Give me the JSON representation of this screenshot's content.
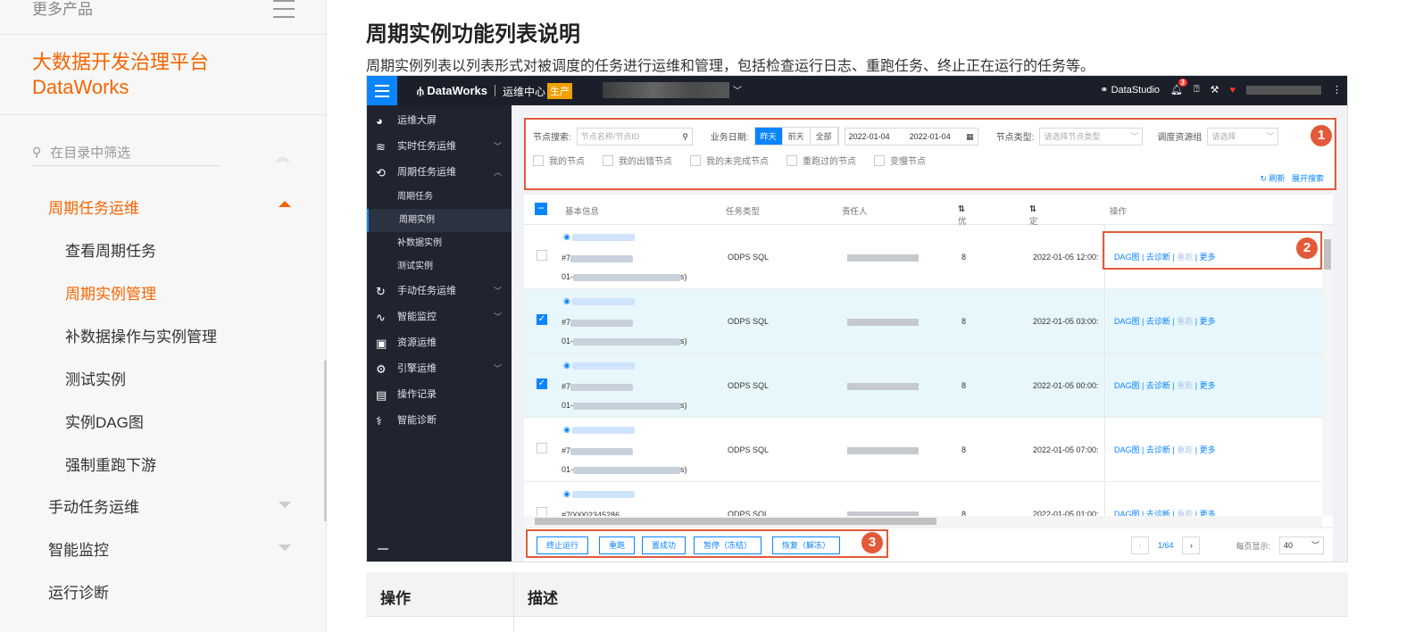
{
  "sidebar": {
    "more_products": "更多产品",
    "product_name_cn": "大数据开发治理平台",
    "product_name_en": "DataWorks",
    "filter_placeholder": "在目录中筛选",
    "items": [
      {
        "label": "周期任务运维",
        "active": true,
        "level": 1
      },
      {
        "label": "查看周期任务",
        "active": false,
        "level": 2
      },
      {
        "label": "周期实例管理",
        "active": true,
        "level": 2
      },
      {
        "label": "补数据操作与实例管理",
        "active": false,
        "level": 2
      },
      {
        "label": "测试实例",
        "active": false,
        "level": 2
      },
      {
        "label": "实例DAG图",
        "active": false,
        "level": 2
      },
      {
        "label": "强制重跑下游",
        "active": false,
        "level": 2
      },
      {
        "label": "手动任务运维",
        "active": false,
        "level": 1
      },
      {
        "label": "智能监控",
        "active": false,
        "level": 1
      },
      {
        "label": "运行诊断",
        "active": false,
        "level": 1
      }
    ]
  },
  "content": {
    "title": "周期实例功能列表说明",
    "description": "周期实例列表以列表形式对被调度的任务进行运维和管理，包括检查运行日志、重跑任务、终止正在运行的任务等。",
    "table_headers": {
      "op": "操作",
      "desc": "描述"
    }
  },
  "screenshot": {
    "topbar": {
      "logo": "DataWorks",
      "module": "运维中心",
      "env": "生产",
      "datastudio": "DataStudio",
      "notify_count": "3"
    },
    "leftnav": [
      {
        "icon": "pie-icon",
        "glyph": "◕",
        "label": "运维大屏"
      },
      {
        "icon": "realtime-icon",
        "glyph": "≋",
        "label": "实时任务运维",
        "arrow": "﹀"
      },
      {
        "icon": "cycle-icon",
        "glyph": "⟲",
        "label": "周期任务运维",
        "arrow": "︿"
      },
      {
        "sub": true,
        "label": "周期任务"
      },
      {
        "sub": true,
        "label": "周期实例",
        "selected": true
      },
      {
        "sub": true,
        "label": "补数据实例"
      },
      {
        "sub": true,
        "label": "测试实例"
      },
      {
        "icon": "manual-icon",
        "glyph": "↻",
        "label": "手动任务运维",
        "arrow": "﹀"
      },
      {
        "icon": "monitor-icon",
        "glyph": "∿",
        "label": "智能监控",
        "arrow": "﹀"
      },
      {
        "icon": "resource-icon",
        "glyph": "▣",
        "label": "资源运维"
      },
      {
        "icon": "engine-icon",
        "glyph": "⚙",
        "label": "引擎运维",
        "arrow": "﹀"
      },
      {
        "icon": "log-icon",
        "glyph": "▤",
        "label": "操作记录"
      },
      {
        "icon": "diagnose-icon",
        "glyph": "⚕",
        "label": "智能诊断"
      }
    ],
    "search": {
      "node_search_label": "节点搜索:",
      "node_search_placeholder": "节点名称/节点ID",
      "biz_date_label": "业务日期:",
      "date_buttons": [
        "昨天",
        "前天",
        "全部"
      ],
      "date_from": "2022-01-04",
      "date_to": "2022-01-04",
      "node_type_label": "节点类型:",
      "node_type_placeholder": "请选择节点类型",
      "resource_group_label": "调度资源组",
      "resource_group_placeholder": "请选择",
      "checkboxes": [
        "我的节点",
        "我的出错节点",
        "我的未完成节点",
        "重跑过的节点",
        "变慢节点"
      ],
      "refresh": "刷新",
      "expand": "展开搜索"
    },
    "grid": {
      "headers": [
        "基本信息",
        "任务类型",
        "责任人",
        "优先级",
        "定时时间",
        "操作"
      ],
      "rows": [
        {
          "id": "#7",
          "time": "01-",
          "suffix": "s)",
          "type": "ODPS SQL",
          "priority": "8",
          "schedule": "2022-01-05 12:00:",
          "checked": false
        },
        {
          "id": "#7",
          "time": "01-",
          "suffix": "s)",
          "type": "ODPS SQL",
          "priority": "8",
          "schedule": "2022-01-05 03:00:",
          "checked": true
        },
        {
          "id": "#7",
          "time": "01-",
          "suffix": "s)",
          "type": "ODPS SQL",
          "priority": "8",
          "schedule": "2022-01-05 00:00:",
          "checked": true
        },
        {
          "id": "#7",
          "time": "01-",
          "suffix": "s)",
          "type": "ODPS SQL",
          "priority": "8",
          "schedule": "2022-01-05 07:00:",
          "checked": false
        },
        {
          "id": "#700002345286",
          "time": "",
          "suffix": "",
          "type": "ODPS SQL",
          "priority": "8",
          "schedule": "2022-01-05 01:00:",
          "checked": false
        }
      ],
      "ops": {
        "dag": "DAG图",
        "diagnose": "去诊断",
        "rerun": "重跑",
        "more": "更多"
      }
    },
    "footer": {
      "buttons": [
        "终止运行",
        "重跑",
        "置成功",
        "暂停（冻结）",
        "恢复（解冻）"
      ],
      "page": "1/64",
      "page_size_label": "每页显示:",
      "page_size": "40"
    },
    "callouts": [
      "1",
      "2",
      "3"
    ]
  }
}
